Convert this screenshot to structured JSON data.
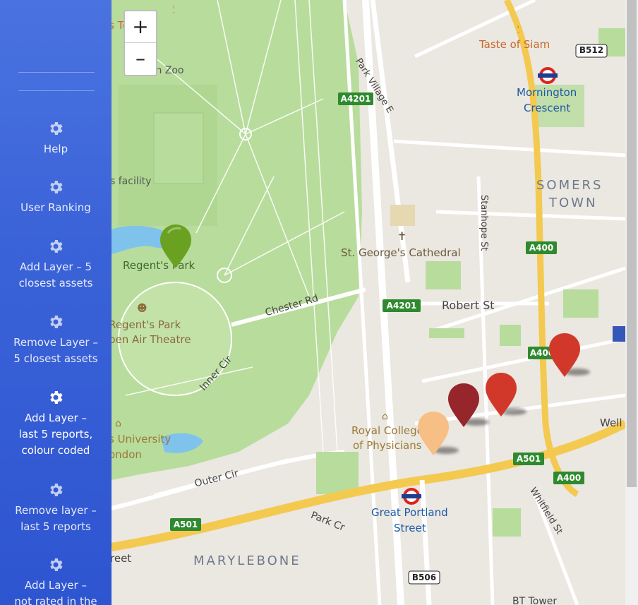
{
  "sidebar": {
    "items": [
      {
        "label": "Help",
        "icon": "gear-icon",
        "active": false
      },
      {
        "label": "User Ranking",
        "icon": "gear-icon",
        "active": false
      },
      {
        "label": "Add Layer – 5\nclosest assets",
        "icon": "gear-icon",
        "active": false
      },
      {
        "label": "Remove Layer –\n5 closest assets",
        "icon": "gear-icon",
        "active": false
      },
      {
        "label": "Add Layer –\nlast 5 reports,\ncolour coded",
        "icon": "gear-icon",
        "active": true
      },
      {
        "label": "Remove layer –\nlast 5 reports",
        "icon": "gear-icon",
        "active": false
      },
      {
        "label": "Add Layer –\nnot rated in the",
        "icon": "gear-icon",
        "active": false
      }
    ]
  },
  "zoom": {
    "in_label": "+",
    "out_label": "–"
  },
  "map": {
    "labels": {
      "terrace": "s Terrace",
      "zoo": "London Zoo",
      "taste_of_siam": "Taste of Siam",
      "b512": "B512",
      "mornington_1": "Mornington",
      "mornington_2": "Crescent",
      "park_village": "Park Village E",
      "a4201_top": "A4201",
      "facility": "s facility",
      "somers_1": "SOMERS",
      "somers_2": "TOWN",
      "stanhope": "Stanhope St",
      "regents_park": "Regent's Park",
      "st_george": "St. George's Cathedral",
      "a400_mid": "A400",
      "chester_rd": "Chester Rd",
      "a4201_mid": "A4201",
      "robert_st": "Robert St",
      "open_air_1": "Regent's Park",
      "open_air_2": "pen Air Theatre",
      "a400_right": "A400",
      "inner_cir": "Inner Cir",
      "royal_college_1": "Royal College",
      "royal_college_2": "of Physicians",
      "university_1": "s University",
      "university_2": "ondon",
      "well": "Well",
      "a501_right": "A501",
      "outer_cir": "Outer Cir",
      "a400_low": "A400",
      "whitfield": "Whitfield St",
      "great_portland_1": "Great Portland",
      "great_portland_2": "Street",
      "park_cr": "Park Cr",
      "a501_left": "A501",
      "reet": "reet",
      "marylebone": "MARYLEBONE",
      "b506": "B506",
      "bt_tower": "BT Tower"
    },
    "markers": [
      {
        "name": "marker-green",
        "color": "#6aa121"
      },
      {
        "name": "marker-red-1",
        "color": "#d2382a"
      },
      {
        "name": "marker-red-2",
        "color": "#d2382a"
      },
      {
        "name": "marker-dark-red",
        "color": "#96262c"
      },
      {
        "name": "marker-peach",
        "color": "#f7bf85"
      }
    ],
    "colors": {
      "park": "#b8dc9c",
      "road_major": "#f4c94f",
      "road_green_badge": "#2f8a2f"
    }
  }
}
